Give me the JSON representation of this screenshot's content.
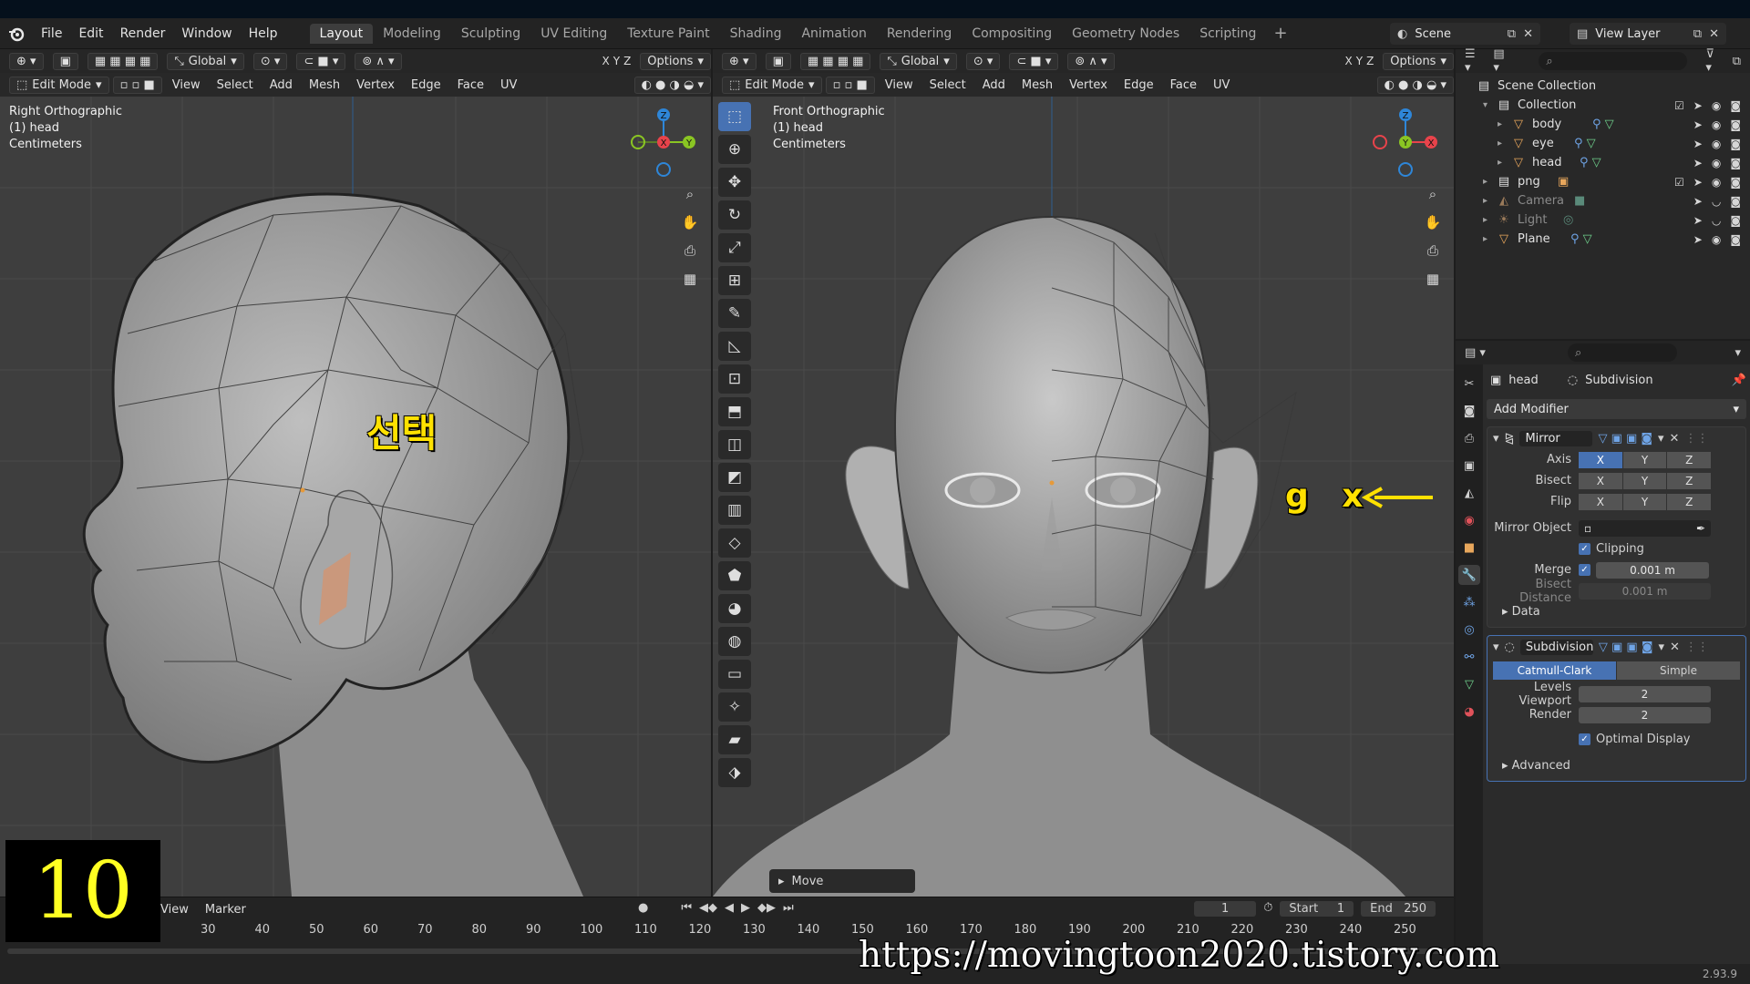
{
  "menubar": {
    "items": [
      "File",
      "Edit",
      "Render",
      "Window",
      "Help"
    ],
    "workspaces": [
      "Layout",
      "Modeling",
      "Sculpting",
      "UV Editing",
      "Texture Paint",
      "Shading",
      "Animation",
      "Rendering",
      "Compositing",
      "Geometry Nodes",
      "Scripting"
    ],
    "active_workspace": "Layout",
    "scene": "Scene",
    "view_layer": "View Layer"
  },
  "viewport_left": {
    "header": {
      "orientation": "Global",
      "options": "Options",
      "mode": "Edit Mode"
    },
    "menus": [
      "View",
      "Select",
      "Add",
      "Mesh",
      "Vertex",
      "Edge",
      "Face",
      "UV"
    ],
    "info": {
      "view": "Right Orthographic",
      "object": "(1) head",
      "units": "Centimeters"
    },
    "annotation": "선택"
  },
  "viewport_right": {
    "header": {
      "orientation": "Global",
      "options": "Options",
      "mode": "Edit Mode"
    },
    "menus": [
      "View",
      "Select",
      "Add",
      "Mesh",
      "Vertex",
      "Edge",
      "Face",
      "UV"
    ],
    "info": {
      "view": "Front Orthographic",
      "object": "(1) head",
      "units": "Centimeters"
    },
    "annotation": "g x",
    "operator_panel": "Move"
  },
  "axis_letters": {
    "x": "X",
    "y": "Y",
    "z": "Z"
  },
  "outliner": {
    "root": "Scene Collection",
    "rows": [
      {
        "name": "Collection",
        "icon": "collection-icon",
        "depth": 1,
        "dim": false
      },
      {
        "name": "body",
        "icon": "mesh-object-icon",
        "depth": 2,
        "dim": false
      },
      {
        "name": "eye",
        "icon": "mesh-object-icon",
        "depth": 2,
        "dim": false
      },
      {
        "name": "head",
        "icon": "mesh-object-icon",
        "depth": 2,
        "dim": false
      },
      {
        "name": "png",
        "icon": "collection-icon",
        "depth": 1,
        "dim": false
      },
      {
        "name": "Camera",
        "icon": "camera-icon",
        "depth": 1,
        "dim": true
      },
      {
        "name": "Light",
        "icon": "light-icon",
        "depth": 1,
        "dim": true
      },
      {
        "name": "Plane",
        "icon": "mesh-object-icon",
        "depth": 1,
        "dim": false
      }
    ]
  },
  "properties": {
    "object": "head",
    "modifier_crumb": "Subdivision",
    "add_modifier": "Add Modifier",
    "mirror": {
      "name": "Mirror",
      "axis_label": "Axis",
      "bisect_label": "Bisect",
      "flip_label": "Flip",
      "mirror_object_label": "Mirror Object",
      "clipping_label": "Clipping",
      "merge_label": "Merge",
      "merge_value": "0.001 m",
      "bisect_distance_label": "Bisect Distance",
      "bisect_distance_value": "0.001 m",
      "data_label": "Data"
    },
    "subdivision": {
      "name": "Subdivision",
      "catmull": "Catmull-Clark",
      "simple": "Simple",
      "levels_viewport_label": "Levels Viewport",
      "levels_viewport": "2",
      "render_label": "Render",
      "render": "2",
      "optimal_label": "Optimal Display",
      "advanced_label": "Advanced"
    }
  },
  "timeline": {
    "menus": [
      "View",
      "Marker"
    ],
    "current_frame": "1",
    "start_label": "Start",
    "start": "1",
    "end_label": "End",
    "end": "250",
    "ticks": [
      "30",
      "40",
      "50",
      "60",
      "70",
      "80",
      "90",
      "100",
      "110",
      "120",
      "130",
      "140",
      "150",
      "160",
      "170",
      "180",
      "190",
      "200",
      "210",
      "220",
      "230",
      "240",
      "250"
    ]
  },
  "status": {
    "version": "2.93.9"
  },
  "overlay": {
    "step_number": "10",
    "watermark": "https://movingtoon2020.tistory.com"
  },
  "colors": {
    "accent": "#4772b3",
    "annotation": "#ffe100",
    "x_axis": "#e8434b",
    "y_axis": "#8ac523",
    "z_axis": "#2e86d8"
  }
}
